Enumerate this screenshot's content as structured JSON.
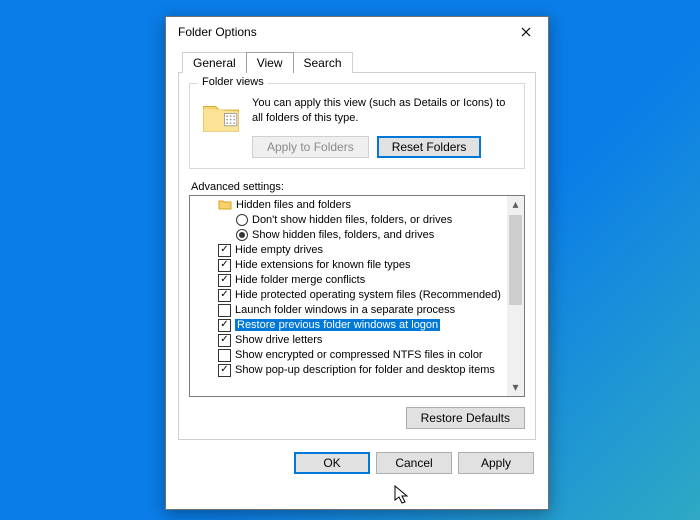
{
  "window": {
    "title": "Folder Options"
  },
  "tabs": {
    "items": [
      {
        "label": "General"
      },
      {
        "label": "View"
      },
      {
        "label": "Search"
      }
    ],
    "active": 1
  },
  "folder_views": {
    "legend": "Folder views",
    "text": "You can apply this view (such as Details or Icons) to all folders of this type.",
    "apply_label": "Apply to Folders",
    "reset_label": "Reset Folders"
  },
  "advanced": {
    "label": "Advanced settings:",
    "items": [
      {
        "type": "folder",
        "indent": 1,
        "label": "Hidden files and folders"
      },
      {
        "type": "radio",
        "indent": 2,
        "checked": false,
        "label": "Don't show hidden files, folders, or drives"
      },
      {
        "type": "radio",
        "indent": 2,
        "checked": true,
        "label": "Show hidden files, folders, and drives"
      },
      {
        "type": "check",
        "indent": 1,
        "checked": true,
        "label": "Hide empty drives"
      },
      {
        "type": "check",
        "indent": 1,
        "checked": true,
        "label": "Hide extensions for known file types"
      },
      {
        "type": "check",
        "indent": 1,
        "checked": true,
        "label": "Hide folder merge conflicts"
      },
      {
        "type": "check",
        "indent": 1,
        "checked": true,
        "label": "Hide protected operating system files (Recommended)"
      },
      {
        "type": "check",
        "indent": 1,
        "checked": false,
        "label": "Launch folder windows in a separate process"
      },
      {
        "type": "check",
        "indent": 1,
        "checked": true,
        "selected": true,
        "label": "Restore previous folder windows at logon"
      },
      {
        "type": "check",
        "indent": 1,
        "checked": true,
        "label": "Show drive letters"
      },
      {
        "type": "check",
        "indent": 1,
        "checked": false,
        "label": "Show encrypted or compressed NTFS files in color"
      },
      {
        "type": "check",
        "indent": 1,
        "checked": true,
        "label": "Show pop-up description for folder and desktop items"
      }
    ],
    "restore_defaults_label": "Restore Defaults"
  },
  "buttons": {
    "ok": "OK",
    "cancel": "Cancel",
    "apply": "Apply"
  }
}
